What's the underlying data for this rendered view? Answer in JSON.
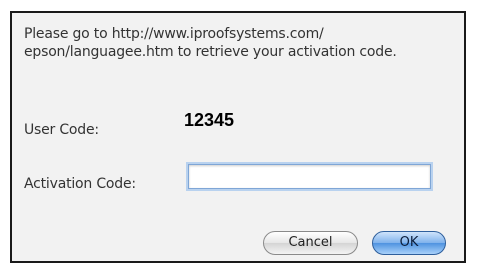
{
  "dialog": {
    "message": "Please go to http://www.iproofsystems.com/ epson/languagee.htm to retrieve your activation code.",
    "user_code_label": "User Code:",
    "user_code_value": "12345",
    "activation_code_label": "Activation Code:",
    "activation_code_value": "",
    "cancel_label": "Cancel",
    "ok_label": "OK"
  },
  "colors": {
    "dialog_background": "#f2f2f2",
    "ok_button_accent": "#4f93e0",
    "input_focus_ring": "#7fa6d6"
  }
}
